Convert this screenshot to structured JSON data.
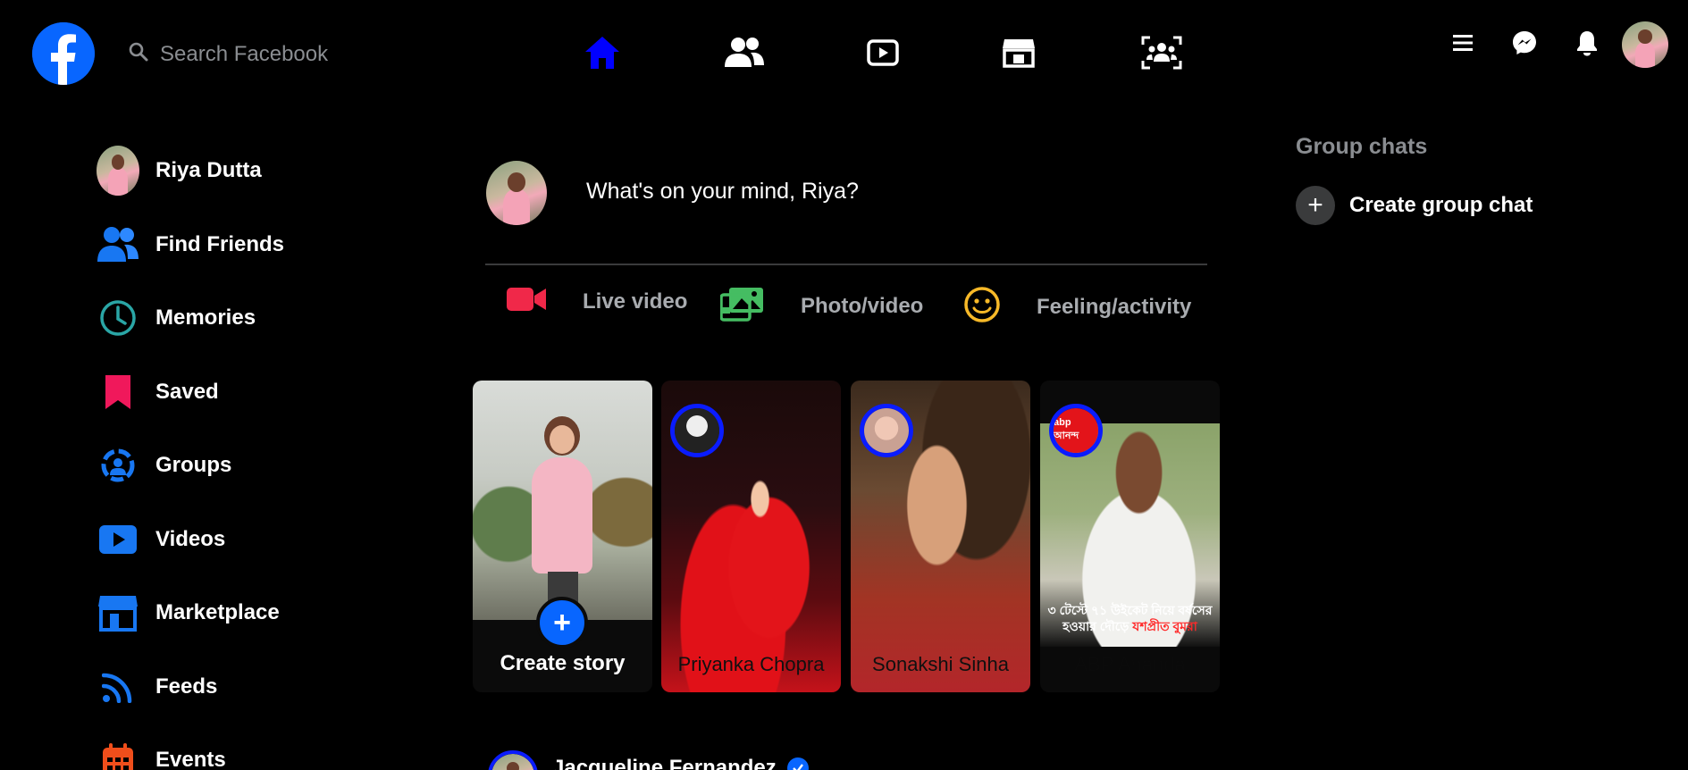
{
  "topbar": {
    "search_placeholder": "Search Facebook",
    "nav_icons": [
      "home-icon",
      "friends-icon",
      "watch-icon",
      "marketplace-icon",
      "groups-icon"
    ],
    "right_icons": [
      "menu-icon",
      "messenger-icon",
      "notifications-icon"
    ],
    "active_color": "#0000ff"
  },
  "sidebar": {
    "items": [
      {
        "label": "Riya Dutta",
        "icon": "profile-avatar"
      },
      {
        "label": "Find Friends",
        "icon": "friends-icon"
      },
      {
        "label": "Memories",
        "icon": "clock-icon"
      },
      {
        "label": "Saved",
        "icon": "bookmark-icon"
      },
      {
        "label": "Groups",
        "icon": "groups-icon"
      },
      {
        "label": "Videos",
        "icon": "video-icon"
      },
      {
        "label": "Marketplace",
        "icon": "marketplace-icon"
      },
      {
        "label": "Feeds",
        "icon": "feeds-icon"
      },
      {
        "label": "Events",
        "icon": "calendar-icon"
      }
    ]
  },
  "composer": {
    "prompt": "What's on your mind, Riya?",
    "actions": [
      {
        "label": "Live video",
        "icon": "live-video-icon",
        "color": "#f02849"
      },
      {
        "label": "Photo/video",
        "icon": "photo-icon",
        "color": "#45bd62"
      },
      {
        "label": "Feeling/activity",
        "icon": "smiley-icon",
        "color": "#f7b928"
      }
    ]
  },
  "stories": {
    "create_label": "Create story",
    "items": [
      {
        "name": "Priyanka Chopra"
      },
      {
        "name": "Sonakshi Sinha"
      },
      {
        "name": "ABP Ananda",
        "headline_a": "৩ টেস্টে ৭১ উইকেট নিয়ে বর্ষসের",
        "headline_b": "হওয়ার দৌড়ে ",
        "headline_hl": "যশপ্রীত বুমরা",
        "badge": "abp আনন্দ"
      }
    ]
  },
  "post": {
    "author": "Jacqueline Fernandez"
  },
  "right_column": {
    "title": "Group chats",
    "create_label": "Create group chat"
  },
  "colors": {
    "brand": "#0866ff",
    "background": "#000000",
    "muted_text": "#a8abaf"
  }
}
